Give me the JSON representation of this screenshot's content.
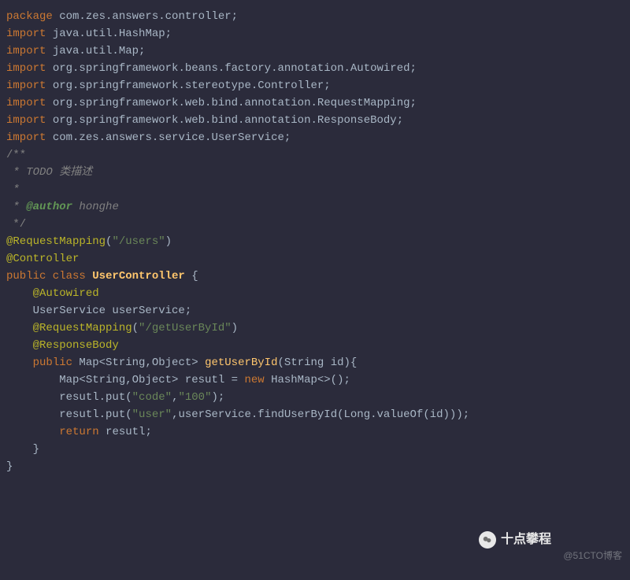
{
  "lines": [
    [
      {
        "c": "kw",
        "t": "package"
      },
      {
        "c": "pkg",
        "t": " com.zes.answers.controller;"
      }
    ],
    [
      {
        "c": "pkg",
        "t": ""
      }
    ],
    [
      {
        "c": "kw",
        "t": "import"
      },
      {
        "c": "pkg",
        "t": " java.util.HashMap;"
      }
    ],
    [
      {
        "c": "kw",
        "t": "import"
      },
      {
        "c": "pkg",
        "t": " java.util.Map;"
      }
    ],
    [
      {
        "c": "pkg",
        "t": ""
      }
    ],
    [
      {
        "c": "kw",
        "t": "import"
      },
      {
        "c": "pkg",
        "t": " org.springframework.beans.factory.annotation.Autowired;"
      }
    ],
    [
      {
        "c": "kw",
        "t": "import"
      },
      {
        "c": "pkg",
        "t": " org.springframework.stereotype.Controller;"
      }
    ],
    [
      {
        "c": "kw",
        "t": "import"
      },
      {
        "c": "pkg",
        "t": " org.springframework.web.bind.annotation.RequestMapping;"
      }
    ],
    [
      {
        "c": "kw",
        "t": "import"
      },
      {
        "c": "pkg",
        "t": " org.springframework.web.bind.annotation.ResponseBody;"
      }
    ],
    [
      {
        "c": "pkg",
        "t": ""
      }
    ],
    [
      {
        "c": "kw",
        "t": "import"
      },
      {
        "c": "pkg",
        "t": " com.zes.answers.service.UserService;"
      }
    ],
    [
      {
        "c": "pkg",
        "t": ""
      }
    ],
    [
      {
        "c": "com",
        "t": "/**"
      }
    ],
    [
      {
        "c": "comi",
        "t": " * TODO 类描述"
      }
    ],
    [
      {
        "c": "comi",
        "t": " *"
      }
    ],
    [
      {
        "c": "comi",
        "t": " * "
      },
      {
        "c": "tag",
        "t": "@author"
      },
      {
        "c": "comi",
        "t": " honghe"
      }
    ],
    [
      {
        "c": "com",
        "t": " */"
      }
    ],
    [
      {
        "c": "ann",
        "t": "@RequestMapping"
      },
      {
        "c": "pkg",
        "t": "("
      },
      {
        "c": "str",
        "t": "\"/users\""
      },
      {
        "c": "pkg",
        "t": ")"
      }
    ],
    [
      {
        "c": "ann",
        "t": "@Controller"
      }
    ],
    [
      {
        "c": "kw",
        "t": "public class "
      },
      {
        "c": "cls",
        "t": "UserController"
      },
      {
        "c": "pkg",
        "t": " {"
      }
    ],
    [
      {
        "c": "pkg",
        "t": ""
      }
    ],
    [
      {
        "c": "pkg",
        "t": "    "
      },
      {
        "c": "ann",
        "t": "@Autowired"
      }
    ],
    [
      {
        "c": "pkg",
        "t": "    UserService userService;"
      }
    ],
    [
      {
        "c": "pkg",
        "t": ""
      }
    ],
    [
      {
        "c": "pkg",
        "t": "    "
      },
      {
        "c": "ann",
        "t": "@RequestMapping"
      },
      {
        "c": "pkg",
        "t": "("
      },
      {
        "c": "str",
        "t": "\"/getUserById\""
      },
      {
        "c": "pkg",
        "t": ")"
      }
    ],
    [
      {
        "c": "pkg",
        "t": "    "
      },
      {
        "c": "ann",
        "t": "@ResponseBody"
      }
    ],
    [
      {
        "c": "pkg",
        "t": "    "
      },
      {
        "c": "kw",
        "t": "public"
      },
      {
        "c": "pkg",
        "t": " Map<String,Object> "
      },
      {
        "c": "mth",
        "t": "getUserById"
      },
      {
        "c": "pkg",
        "t": "(String id){"
      }
    ],
    [
      {
        "c": "pkg",
        "t": "        Map<String,Object> resutl = "
      },
      {
        "c": "new",
        "t": "new"
      },
      {
        "c": "pkg",
        "t": " HashMap<>();"
      }
    ],
    [
      {
        "c": "pkg",
        "t": "        resutl.put("
      },
      {
        "c": "str",
        "t": "\"code\""
      },
      {
        "c": "pkg",
        "t": ","
      },
      {
        "c": "str",
        "t": "\"100\""
      },
      {
        "c": "pkg",
        "t": ");"
      }
    ],
    [
      {
        "c": "pkg",
        "t": "        resutl.put("
      },
      {
        "c": "str",
        "t": "\"user\""
      },
      {
        "c": "pkg",
        "t": ",userService.findUserById(Long.valueOf(id)));"
      }
    ],
    [
      {
        "c": "pkg",
        "t": "        "
      },
      {
        "c": "kw",
        "t": "return"
      },
      {
        "c": "pkg",
        "t": " resutl;"
      }
    ],
    [
      {
        "c": "pkg",
        "t": "    }"
      }
    ],
    [
      {
        "c": "pkg",
        "t": "}"
      }
    ]
  ],
  "watermark_bubble": "十点攀程",
  "watermark_text": "@51CTO博客"
}
